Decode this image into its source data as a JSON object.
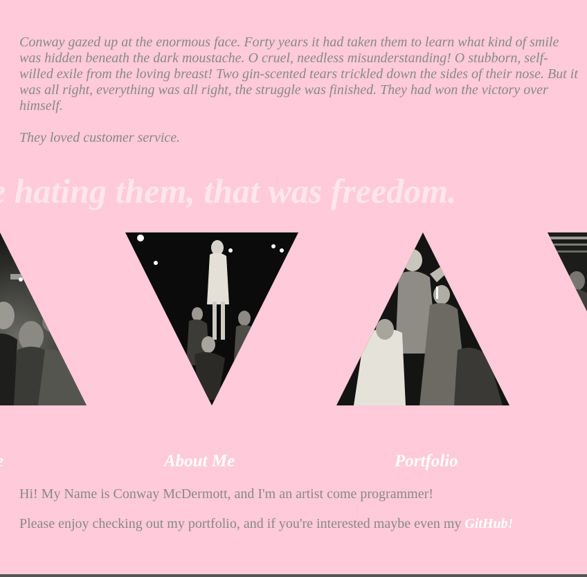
{
  "quote": {
    "paragraph": "Conway gazed up at the enormous face. Forty years it had taken them to learn what kind of smile was hidden beneath the dark moustache. O cruel, needless misunderstanding! O stubborn, self-willed exile from the loving breast! Two gin-scented tears trickled down the sides of their nose. But it was all right, everything was all right, the struggle was finished. They had won the victory over himself.",
    "closing": "They loved customer service."
  },
  "banner": {
    "text": "e hating them, that was freedom."
  },
  "gallery": {
    "images": [
      {
        "name": "concert-photo-1",
        "shape": "triangle-up"
      },
      {
        "name": "concert-photo-2",
        "shape": "triangle-down"
      },
      {
        "name": "concert-photo-3",
        "shape": "triangle-up"
      },
      {
        "name": "concert-photo-4",
        "shape": "triangle-down"
      }
    ]
  },
  "nav": {
    "home_label": "e",
    "about_label": "About Me",
    "portfolio_label": "Portfolio"
  },
  "intro": {
    "line1": "Hi! My Name is Conway McDermott, and I'm an artist come programmer!",
    "line2_prefix": "Please enjoy checking out my portfolio, and if you're interested maybe even my ",
    "github_label": "GitHub!"
  },
  "colors": {
    "background": "#ffcad9",
    "body_text": "#888888",
    "banner_text": "#ffe6ee",
    "link_text": "#ffffff"
  }
}
